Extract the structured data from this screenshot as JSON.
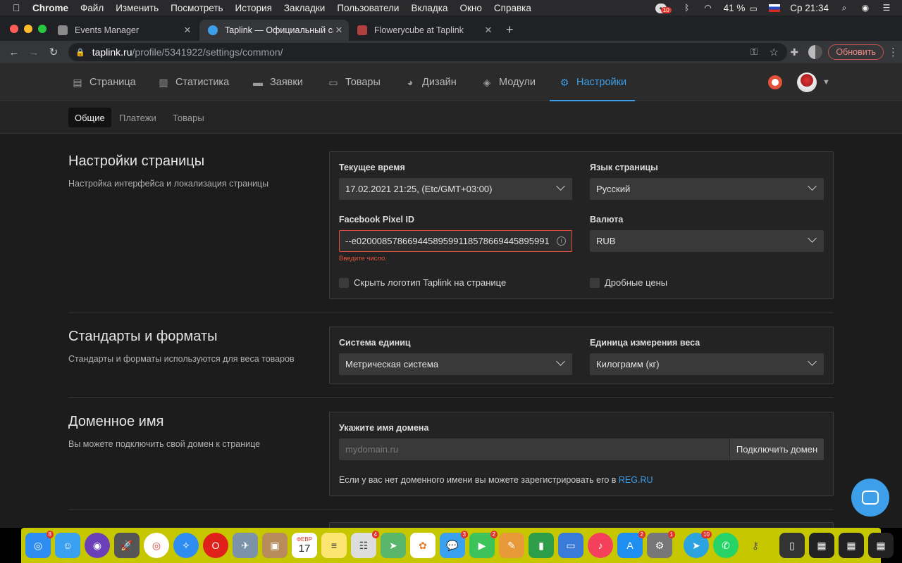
{
  "menubar": {
    "app": "Chrome",
    "items": [
      "Файл",
      "Изменить",
      "Посмотреть",
      "История",
      "Закладки",
      "Пользователи",
      "Вкладка",
      "Окно",
      "Справка"
    ],
    "battery": "41 %",
    "clock": "Ср 21:34",
    "notif_badge": "10"
  },
  "browser": {
    "tabs": [
      {
        "title": "Events Manager"
      },
      {
        "title": "Taplink — Официальный сайт"
      },
      {
        "title": "Flowerycube at Taplink"
      }
    ],
    "url_host": "taplink.ru",
    "url_path": "/profile/5341922/settings/common/",
    "update_label": "Обновить"
  },
  "nav": {
    "items": [
      {
        "label": "Страница"
      },
      {
        "label": "Статистика"
      },
      {
        "label": "Заявки"
      },
      {
        "label": "Товары"
      },
      {
        "label": "Дизайн"
      },
      {
        "label": "Модули"
      },
      {
        "label": "Настройки"
      }
    ],
    "subtabs": [
      "Общие",
      "Платежи",
      "Товары"
    ]
  },
  "page_settings": {
    "title": "Настройки страницы",
    "desc": "Настройка интерфейса и локализация страницы",
    "time_label": "Текущее время",
    "time_value": "17.02.2021 21:25, (Etc/GMT+03:00)",
    "lang_label": "Язык страницы",
    "lang_value": "Русский",
    "pixel_label": "Facebook Pixel ID",
    "pixel_value": "--e020008578669445895991185786694458959​91",
    "pixel_error": "Введите число.",
    "currency_label": "Валюта",
    "currency_value": "RUB",
    "hide_logo": "Скрыть логотип Taplink на странице",
    "fraction_prices": "Дробные цены"
  },
  "standards": {
    "title": "Стандарты и форматы",
    "desc": "Стандарты и форматы используются для веса товаров",
    "units_label": "Система единиц",
    "units_value": "Метрическая система",
    "weight_label": "Единица измерения веса",
    "weight_value": "Килограмм (кг)"
  },
  "domain": {
    "title": "Доменное имя",
    "desc": "Вы можете подключить свой домен к странице",
    "field_label": "Укажите имя домена",
    "placeholder": "mydomain.ru",
    "connect_label": "Подключить домен",
    "note_prefix": "Если у вас нет доменного имени вы можете зарегистрировать его в",
    "note_link": "REG.RU"
  },
  "dock": {
    "badges": [
      "8",
      "4",
      "3",
      "2",
      "2",
      "1",
      "10"
    ],
    "calendar_month": "ФЕВР",
    "calendar_day": "17"
  }
}
